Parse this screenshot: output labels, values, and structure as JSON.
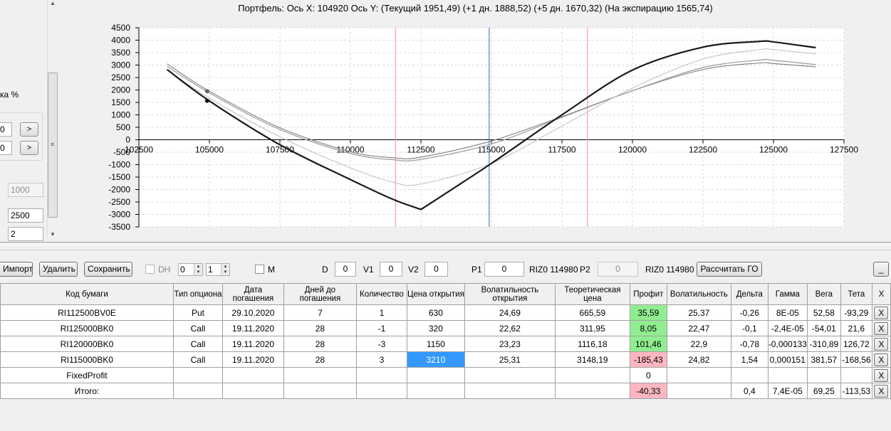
{
  "chart": {
    "title": "Портфель: Ось X: 104920 Ось Y:  (Текущий 1951,49)  (+1 дн. 1888,52)  (+5 дн. 1670,32)  (На экспирацию 1565,74)"
  },
  "chart_data": {
    "type": "line",
    "xlim": [
      102500,
      127500
    ],
    "ylim": [
      -3500,
      4500
    ],
    "x_ticks": [
      "102500",
      "105000",
      "107500",
      "110000",
      "112500",
      "115000",
      "117500",
      "120000",
      "122500",
      "125000",
      "127500"
    ],
    "y_ticks": [
      "4500",
      "4000",
      "3500",
      "3000",
      "2500",
      "2000",
      "1500",
      "1000",
      "500",
      "0",
      "-500",
      "-1000",
      "-1500",
      "-2000",
      "-2500",
      "-3000",
      "-3500"
    ],
    "grid": true,
    "vertical_markers": [
      {
        "x": 111600,
        "color": "#ff9aa8"
      },
      {
        "x": 114920,
        "color": "#4f7fc0"
      },
      {
        "x": 118400,
        "color": "#ff9aa8"
      }
    ],
    "series": [
      {
        "color": "#888888",
        "width": 1.2,
        "x": [
          103500,
          105000,
          107500,
          110000,
          111500,
          112500,
          115000,
          117500,
          120000,
          122500,
          124500,
          125000,
          126500
        ],
        "y": [
          3050,
          1950,
          480,
          -480,
          -720,
          -700,
          -50,
          930,
          1970,
          2820,
          3080,
          3060,
          2930
        ]
      },
      {
        "color": "#9a9a9a",
        "width": 1.2,
        "x": [
          103500,
          105000,
          107500,
          110000,
          111500,
          112500,
          115000,
          117500,
          120000,
          122500,
          124500,
          125000,
          126500
        ],
        "y": [
          2950,
          1880,
          410,
          -550,
          -800,
          -790,
          -170,
          900,
          1970,
          2900,
          3200,
          3190,
          3020
        ]
      },
      {
        "color": "#c8c8c8",
        "width": 1.2,
        "x": [
          103500,
          105000,
          107500,
          110000,
          111500,
          112500,
          115000,
          117500,
          120000,
          122500,
          124500,
          125000,
          126500
        ],
        "y": [
          2820,
          1670,
          120,
          -1130,
          -1700,
          -1780,
          -950,
          550,
          2080,
          3240,
          3620,
          3620,
          3450
        ]
      },
      {
        "color": "#1a1a1a",
        "width": 2.2,
        "x": [
          103500,
          105000,
          107500,
          110000,
          111500,
          112500,
          115000,
          117500,
          120000,
          122500,
          124500,
          125000,
          126500
        ],
        "y": [
          2820,
          1560,
          -200,
          -1600,
          -2390,
          -2800,
          -950,
          1000,
          2800,
          3720,
          3950,
          3930,
          3700
        ]
      }
    ],
    "points": [
      {
        "x": 104920,
        "y": 1951,
        "color": "#666666"
      },
      {
        "x": 104920,
        "y": 1566,
        "color": "#111111"
      }
    ]
  },
  "left_panel": {
    "label": "ка %",
    "input1": "0",
    "input2": "0",
    "btn1": ">",
    "btn2": ">",
    "field1": "1000",
    "field2": "2500",
    "field3": "2"
  },
  "toolbar": {
    "import_label": "Импорт",
    "delete_label": "Удалить",
    "save_label": "Сохранить",
    "dh_label": "DH",
    "spin1_value": "0",
    "spin2_value": "1",
    "m_label": "M",
    "d_label": "D",
    "d_value": "0",
    "v1_label": "V1",
    "v1_value": "0",
    "v2_label": "V2",
    "v2_value": "0",
    "p1_label": "P1",
    "p1_value": "0",
    "riz1_label": "RIZ0 114980",
    "p2_label": "P2",
    "p2_value": "0",
    "riz2_label": "RIZ0 114980",
    "calc_label": "Рассчитать ГО",
    "minimize_label": "_"
  },
  "table": {
    "headers": [
      "Код бумаги",
      "Тип опциона",
      "Дата погашения",
      "Дней до погашения",
      "Количество",
      "Цена открытия",
      "Волатильность открытия",
      "Теоретическая цена",
      "Профит",
      "Волатильность",
      "Дельта",
      "Гамма",
      "Вега",
      "Тета",
      "X"
    ],
    "rows": [
      [
        "RI112500BV0E",
        "Put",
        "29.10.2020",
        "7",
        "1",
        "630",
        "24,69",
        "665,59",
        "35,59",
        "25,37",
        "-0,26",
        "8E-05",
        "52,58",
        "-93,29",
        "X"
      ],
      [
        "RI125000BK0",
        "Call",
        "19.11.2020",
        "28",
        "-1",
        "320",
        "22,62",
        "311,95",
        "8,05",
        "22,47",
        "-0,1",
        "-2,4E-05",
        "-54,01",
        "21,6",
        "X"
      ],
      [
        "RI120000BK0",
        "Call",
        "19.11.2020",
        "28",
        "-3",
        "1150",
        "23,23",
        "1116,18",
        "101,46",
        "22,9",
        "-0,78",
        "-0,000133",
        "-310,89",
        "126,72",
        "X"
      ],
      [
        "RI115000BK0",
        "Call",
        "19.11.2020",
        "28",
        "3",
        "3210",
        "25,31",
        "3148,19",
        "-185,43",
        "24,82",
        "1,54",
        "0,000151",
        "381,57",
        "-168,56",
        "X"
      ],
      [
        "FixedProfit",
        "",
        "",
        "",
        "",
        "",
        "",
        "",
        "0",
        "",
        "",
        "",
        "",
        "",
        "X"
      ],
      [
        "Итого:",
        "",
        "",
        "",
        "",
        "",
        "",
        "",
        "-40,33",
        "",
        "0,4",
        "7,4E-05",
        "69,25",
        "-113,53",
        "X"
      ]
    ],
    "cell_colors": {
      "0-8": "green",
      "1-8": "green",
      "2-8": "green",
      "3-8": "pink",
      "5-8": "pink",
      "3-5": "blue"
    }
  }
}
